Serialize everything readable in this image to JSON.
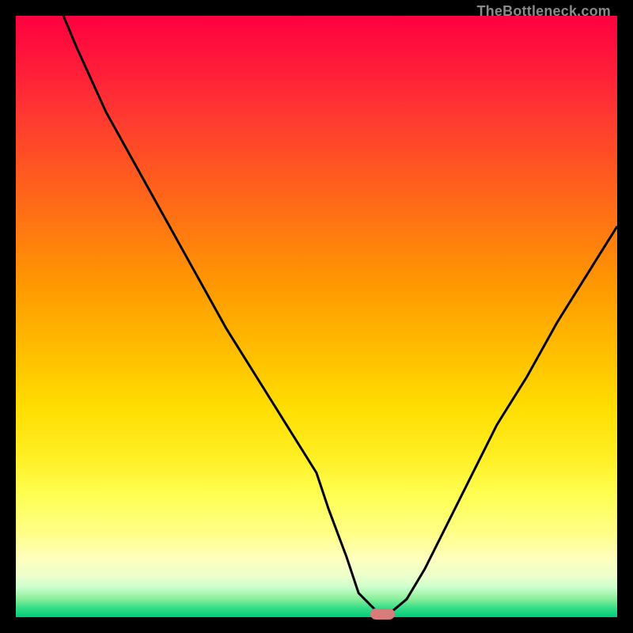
{
  "watermark": "TheBottleneck.com",
  "colors": {
    "frame": "#000000",
    "curve": "#000000",
    "marker_fill": "#d77b7b",
    "gradient_top": "#ff0040",
    "gradient_bottom": "#00cc77"
  },
  "chart_data": {
    "type": "line",
    "title": "",
    "xlabel": "",
    "ylabel": "",
    "xlim": [
      0,
      100
    ],
    "ylim": [
      0,
      100
    ],
    "grid": false,
    "legend": false,
    "background": "vertical-gradient red→orange→yellow→green",
    "series": [
      {
        "name": "bottleneck-curve",
        "x": [
          0,
          5,
          10,
          15,
          20,
          25,
          30,
          35,
          40,
          45,
          50,
          52,
          55,
          57,
          60,
          62,
          65,
          68,
          72,
          76,
          80,
          85,
          90,
          95,
          100
        ],
        "values": [
          118,
          107,
          95,
          84,
          75,
          66,
          57,
          48,
          40,
          32,
          24,
          18,
          10,
          4,
          1,
          0.5,
          3,
          8,
          16,
          24,
          32,
          40,
          49,
          57,
          65
        ]
      }
    ],
    "marker": {
      "x": 61,
      "y": 0.5,
      "width": 4,
      "height": 1.8,
      "color": "#d77b7b"
    }
  }
}
